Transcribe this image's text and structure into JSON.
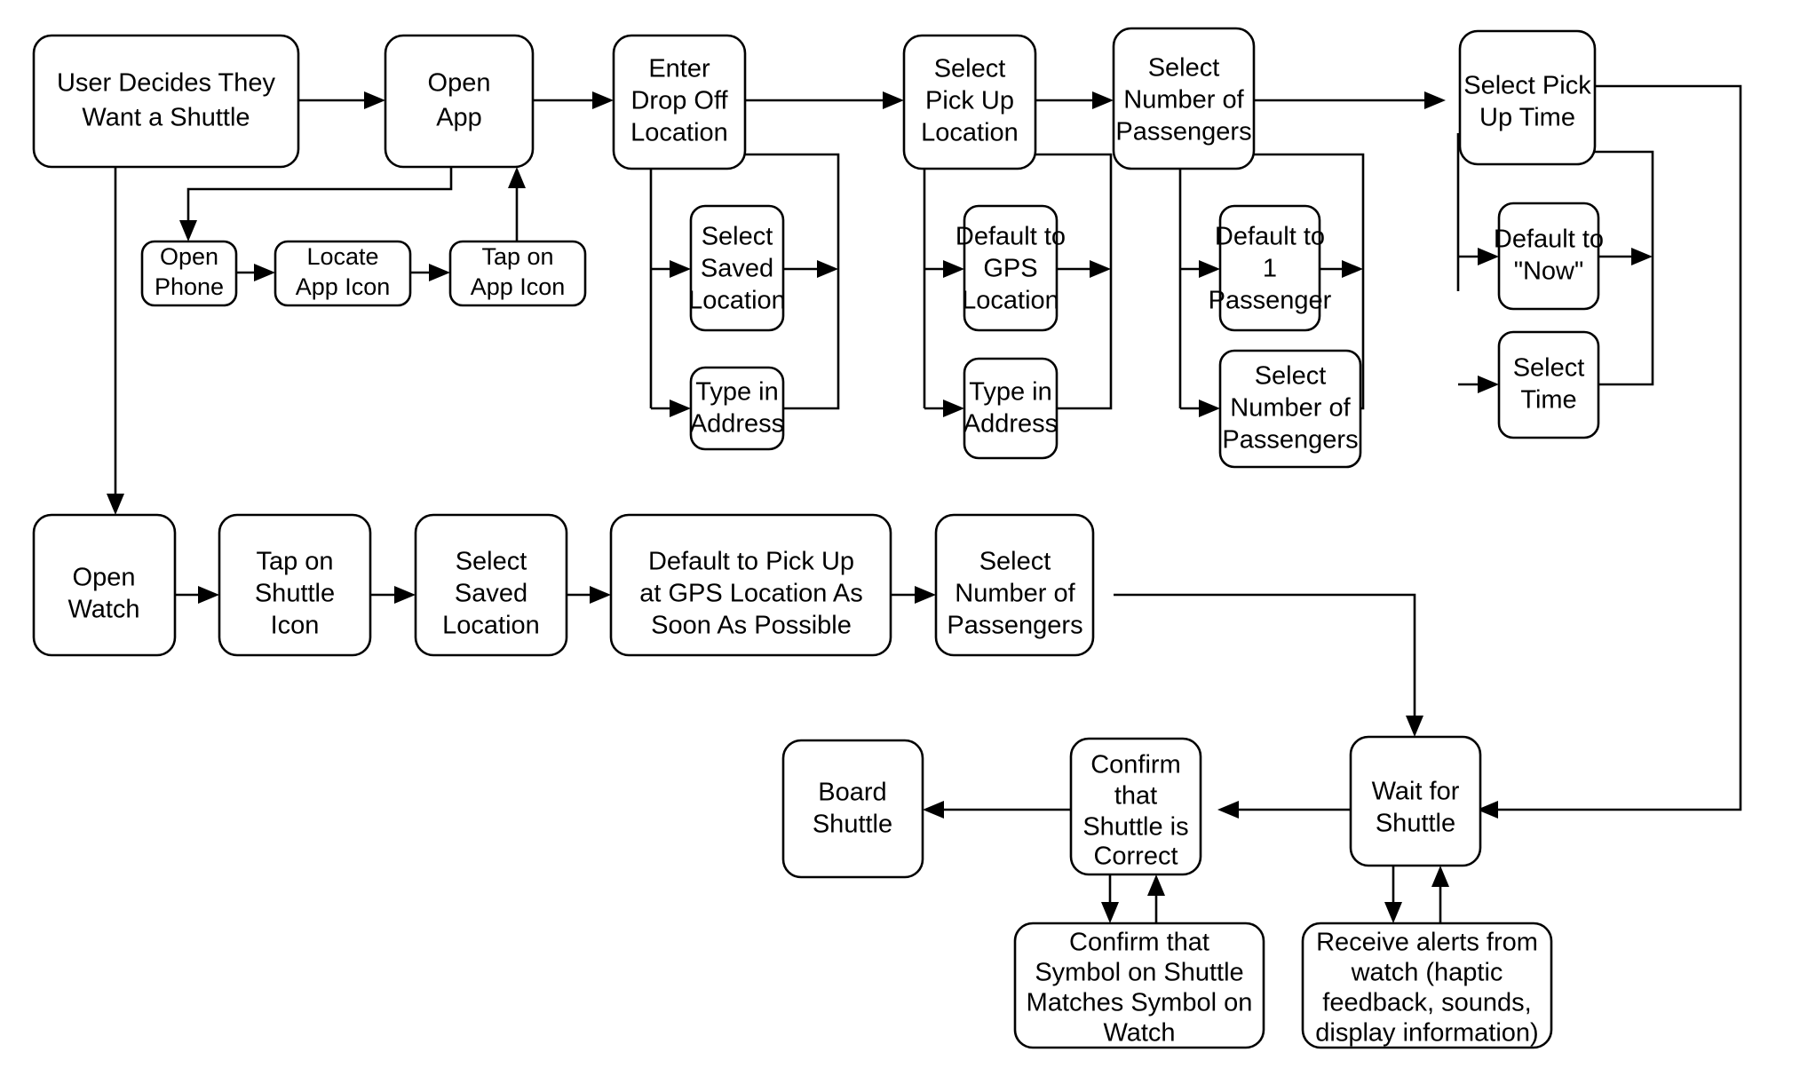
{
  "diagram": {
    "title": "Shuttle Request User Flow",
    "background_color": "#ffffff",
    "stroke_color": "#000000",
    "text_color": "#000000"
  },
  "nodes": {
    "user_decides": {
      "label": "User Decides They\nWant a Shuttle",
      "lines": [
        "User Decides They",
        "Want a Shuttle"
      ]
    },
    "open_app": {
      "label": "Open\nApp",
      "lines": [
        "Open",
        "App"
      ]
    },
    "open_phone": {
      "label": "Open\nPhone",
      "lines": [
        "Open",
        "Phone"
      ]
    },
    "locate_app_icon": {
      "label": "Locate\nApp Icon",
      "lines": [
        "Locate",
        "App Icon"
      ]
    },
    "tap_on_app_icon": {
      "label": "Tap on\nApp Icon",
      "lines": [
        "Tap on",
        "App Icon"
      ]
    },
    "enter_drop_off": {
      "label": "Enter\nDrop Off\nLocation",
      "lines": [
        "Enter",
        "Drop Off",
        "Location"
      ]
    },
    "select_saved_location_1": {
      "label": "Select\nSaved\nLocation",
      "lines": [
        "Select",
        "Saved",
        "Location"
      ]
    },
    "type_in_address_1": {
      "label": "Type in\nAddress",
      "lines": [
        "Type in",
        "Address"
      ]
    },
    "select_pick_up_location": {
      "label": "Select\nPick Up\nLocation",
      "lines": [
        "Select",
        "Pick Up",
        "Location"
      ]
    },
    "default_to_gps_location": {
      "label": "Default to\nGPS\nLocation",
      "lines": [
        "Default to",
        "GPS",
        "Location"
      ]
    },
    "type_in_address_2": {
      "label": "Type in\nAddress",
      "lines": [
        "Type in",
        "Address"
      ]
    },
    "select_number_of_passengers_1": {
      "label": "Select\nNumber of\nPassengers",
      "lines": [
        "Select",
        "Number of",
        "Passengers"
      ]
    },
    "default_to_1_passenger": {
      "label": "Default to\n1\nPassenger",
      "lines": [
        "Default to",
        "1",
        "Passenger"
      ]
    },
    "select_number_of_passengers_2": {
      "label": "Select\nNumber of\nPassengers",
      "lines": [
        "Select",
        "Number of",
        "Passengers"
      ]
    },
    "select_pick_up_time": {
      "label": "Select Pick\nUp Time",
      "lines": [
        "Select Pick",
        "Up Time"
      ]
    },
    "default_to_now": {
      "label": "Default to\n\"Now\"",
      "lines": [
        "Default to",
        "\"Now\""
      ]
    },
    "select_time": {
      "label": "Select\nTime",
      "lines": [
        "Select",
        "Time"
      ]
    },
    "open_watch": {
      "label": "Open\nWatch",
      "lines": [
        "Open",
        "Watch"
      ]
    },
    "tap_on_shuttle_icon": {
      "label": "Tap on\nShuttle\nIcon",
      "lines": [
        "Tap on",
        "Shuttle",
        "Icon"
      ]
    },
    "select_saved_location_2": {
      "label": "Select\nSaved\nLocation",
      "lines": [
        "Select",
        "Saved",
        "Location"
      ]
    },
    "default_pick_up_gps_asap": {
      "label": "Default to Pick Up\nat GPS Location As\nSoon As Possible",
      "lines": [
        "Default to Pick Up",
        "at GPS Location As",
        "Soon As Possible"
      ]
    },
    "select_number_of_passengers_3": {
      "label": "Select\nNumber of\nPassengers",
      "lines": [
        "Select",
        "Number of",
        "Passengers"
      ]
    },
    "board_shuttle": {
      "label": "Board\nShuttle",
      "lines": [
        "Board",
        "Shuttle"
      ]
    },
    "confirm_shuttle_correct": {
      "label": "Confirm\nthat\nShuttle is\nCorrect",
      "lines": [
        "Confirm",
        "that",
        "Shuttle is",
        "Correct"
      ]
    },
    "confirm_symbol_matches": {
      "label": "Confirm that\nSymbol on Shuttle\nMatches Symbol on\nWatch",
      "lines": [
        "Confirm that",
        "Symbol on Shuttle",
        "Matches Symbol on",
        "Watch"
      ]
    },
    "wait_for_shuttle": {
      "label": "Wait for\nShuttle",
      "lines": [
        "Wait for",
        "Shuttle"
      ]
    },
    "receive_alerts_from_watch": {
      "label": "Receive alerts from\nwatch (haptic\nfeedback, sounds,\ndisplay information)",
      "lines": [
        "Receive alerts from",
        "watch (haptic",
        "feedback, sounds,",
        "display information)"
      ]
    }
  }
}
